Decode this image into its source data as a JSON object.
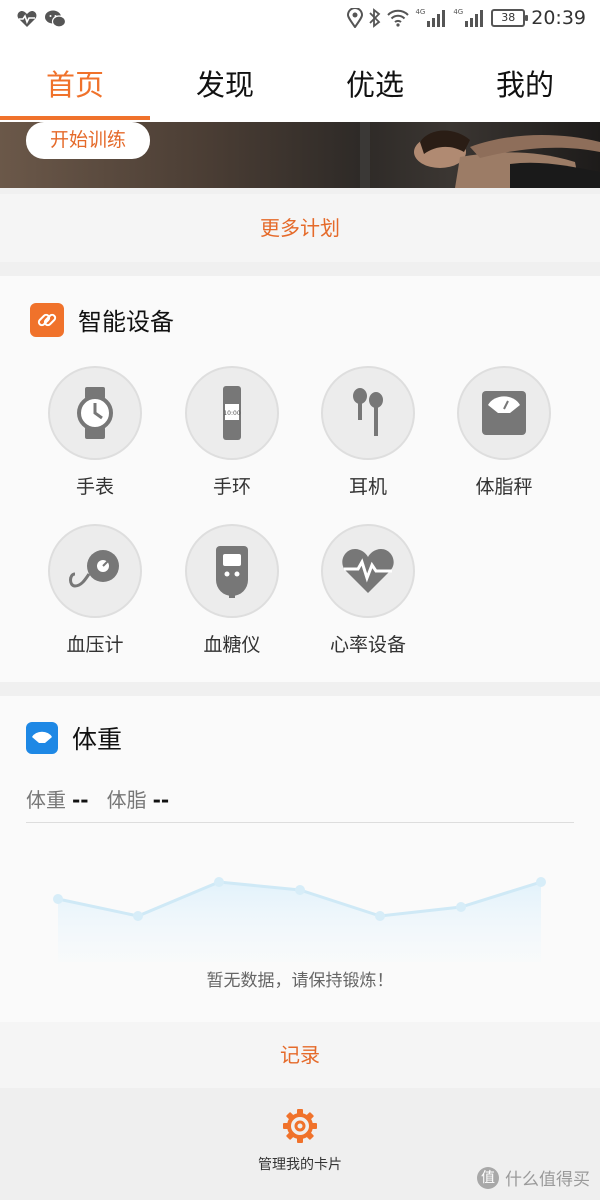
{
  "status_bar": {
    "left_icons": [
      "heart-rate-icon",
      "wechat-icon"
    ],
    "network_1": "4G",
    "network_2": "4G",
    "battery": "38",
    "time": "20:39"
  },
  "tabs": [
    {
      "label": "首页",
      "active": true
    },
    {
      "label": "发现",
      "active": false
    },
    {
      "label": "优选",
      "active": false
    },
    {
      "label": "我的",
      "active": false
    }
  ],
  "accent_color": "#f0722b",
  "banner": {
    "start_button": "开始训练"
  },
  "more_plans": "更多计划",
  "devices": {
    "title": "智能设备",
    "icon": "link-icon",
    "items": [
      {
        "label": "手表",
        "icon": "watch-icon"
      },
      {
        "label": "手环",
        "icon": "band-icon",
        "display_text": "10:00"
      },
      {
        "label": "耳机",
        "icon": "earphones-icon"
      },
      {
        "label": "体脂秤",
        "icon": "scale-icon"
      },
      {
        "label": "血压计",
        "icon": "blood-pressure-icon"
      },
      {
        "label": "血糖仪",
        "icon": "glucose-meter-icon"
      },
      {
        "label": "心率设备",
        "icon": "heart-rate-icon"
      }
    ]
  },
  "weight": {
    "title": "体重",
    "icon": "scale-icon",
    "weight_label": "体重",
    "weight_value": "--",
    "fat_label": "体脂",
    "fat_value": "--",
    "no_data": "暂无数据，请保持锻炼！"
  },
  "record": "记录",
  "manage": {
    "label": "管理我的卡片",
    "icon": "gear-icon"
  },
  "watermark": {
    "text": "什么值得买",
    "icon_text": "值"
  }
}
